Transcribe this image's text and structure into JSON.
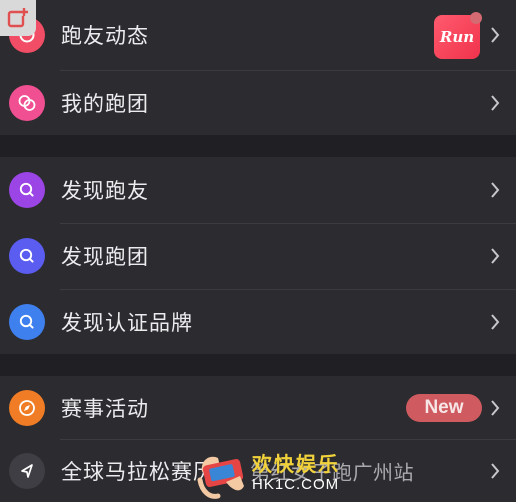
{
  "groups": [
    {
      "items": [
        {
          "label": "跑友动态",
          "badge_text": "Run",
          "icon": "ring-icon",
          "color": "#f24d66"
        },
        {
          "label": "我的跑团",
          "icon": "linked-rings-icon",
          "color": "#f04f91"
        }
      ]
    },
    {
      "items": [
        {
          "label": "发现跑友",
          "icon": "search-icon",
          "color": "#9b45e6"
        },
        {
          "label": "发现跑团",
          "icon": "search-icon",
          "color": "#5b5cf0"
        },
        {
          "label": "发现认证品牌",
          "icon": "search-icon",
          "color": "#3f80ef"
        }
      ]
    },
    {
      "items": [
        {
          "label": "赛事活动",
          "badge_text": "New",
          "icon": "compass-icon",
          "color": "#f07d25"
        },
        {
          "label": "全球马拉松赛历",
          "marquee": "第红女子跑广州站",
          "icon": "location-arrow-icon",
          "color": "#3e3e44"
        }
      ]
    }
  ],
  "watermark": {
    "title": "欢快娱乐",
    "url": "HK1C.COM"
  }
}
